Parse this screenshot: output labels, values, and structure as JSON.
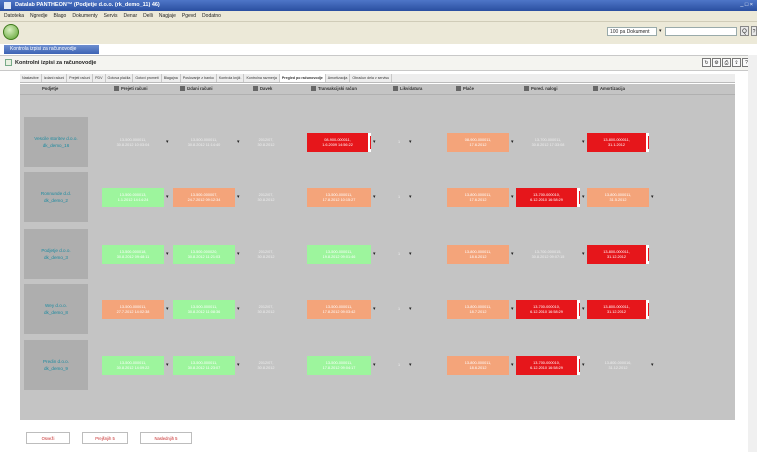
{
  "window": {
    "title": "Datalab PANTHEON™ (Podjetje d.o.o. (rk_demo_11) 46)",
    "controls": "_ □ ×"
  },
  "menu": [
    "Datoteka",
    "Ngredje",
    "Blago",
    "Dokumenty",
    "Servis",
    "Denar",
    "Delli",
    "Nagjaje",
    "Pgevd",
    "Dodatno"
  ],
  "toolbar": {
    "doc_select_label": "100 pa",
    "doc_select_value": "Dokument",
    "search_btn": "Q",
    "help_btn": "?"
  },
  "doc_tab": "Kontrola izpisi za računovodje",
  "panel": {
    "title": "Kontrolni izpisi za računovodje",
    "icons": [
      "refresh-icon",
      "settings-icon",
      "print-icon",
      "export-icon",
      "help-icon"
    ]
  },
  "nav_tabs": [
    "Nastavitve",
    "Izdani računi",
    "Prejeti računi",
    "PDV",
    "Gotova plačila",
    "Gotovi prometi",
    "Blagajna",
    "Poslovanje z banko",
    "Kontrola knjiž.",
    "Kontrolna razmerja",
    "Pregled po računovodje",
    "Amortizacija",
    "Obračun dela v servisu"
  ],
  "active_tab_index": 10,
  "columns": [
    {
      "key": "company",
      "label": "Podjetje",
      "icon": ""
    },
    {
      "key": "received",
      "label": "Prejeti računi",
      "icon": "inbox-icon"
    },
    {
      "key": "issued",
      "label": "Izdani računi",
      "icon": "outbox-icon"
    },
    {
      "key": "tax",
      "label": "Davek",
      "icon": "tax-icon"
    },
    {
      "key": "transactions",
      "label": "Transakcijski račun",
      "icon": "bank-icon"
    },
    {
      "key": "liquidity",
      "label": "Likvidatura",
      "icon": "list-icon"
    },
    {
      "key": "payroll",
      "label": "Plače",
      "icon": "people-icon"
    },
    {
      "key": "fixed",
      "label": "Pored. nalogi",
      "icon": "chart-icon"
    },
    {
      "key": "depreciation",
      "label": "Amortizacija",
      "icon": "doc-icon"
    }
  ],
  "rows": [
    {
      "company": [
        "Vescile storitev d.o.o.",
        "dk_demo_16"
      ],
      "received": {
        "status": "plain",
        "lines": [
          "13-500-000011,",
          "30.8.2012 10:03:04"
        ]
      },
      "issued": {
        "status": "plain",
        "lines": [
          "13-500-000011,",
          "30.8.2012 11:14:40"
        ]
      },
      "tax": {
        "status": "plain",
        "lines": [
          "2012/07,",
          "30.8.2012"
        ]
      },
      "transactions": {
        "status": "red",
        "lines": [
          "08-900-000011,",
          "1.6.2009 14:56:22"
        ]
      },
      "liquidity": {
        "status": "plain",
        "lines": [
          "1"
        ]
      },
      "payroll": {
        "status": "orange",
        "lines": [
          "08-900-000011,",
          "17.6.2012"
        ]
      },
      "fixed": {
        "status": "plain",
        "lines": [
          "13-700-000011,",
          "30.8.2012 17:33:08"
        ]
      },
      "depreciation": {
        "status": "red",
        "lines": [
          "13-800-000011,",
          "31.1.2012"
        ]
      }
    },
    {
      "company": [
        "Ronnunde d.d.",
        "dk_demo_2"
      ],
      "received": {
        "status": "green",
        "lines": [
          "13-500-000013,",
          "1.1.2012 14:14:24"
        ]
      },
      "issued": {
        "status": "orange",
        "lines": [
          "13-500-000007,",
          "24.7.2012 09:12:34"
        ]
      },
      "tax": {
        "status": "plain",
        "lines": [
          "2012/07,",
          "30.8.2012"
        ]
      },
      "transactions": {
        "status": "orange",
        "lines": [
          "13-500-000011,",
          "17.8.2012 10:15:27"
        ]
      },
      "liquidity": {
        "status": "plain",
        "lines": [
          "1"
        ]
      },
      "payroll": {
        "status": "orange",
        "lines": [
          "13-800-000011,",
          "17.6.2012"
        ]
      },
      "fixed": {
        "status": "red",
        "lines": [
          "13-700-000010,",
          "6.12.2010 16:58:29"
        ]
      },
      "depreciation": {
        "status": "orange",
        "lines": [
          "13-800-000011,",
          "31.5.2012"
        ]
      }
    },
    {
      "company": [
        "Podjetje d.o.o.",
        "dk_demo_3"
      ],
      "received": {
        "status": "green",
        "lines": [
          "13-500-000018,",
          "30.8.2012 09:48:11"
        ]
      },
      "issued": {
        "status": "green",
        "lines": [
          "13-500-000020,",
          "30.8.2012 11:21:03"
        ]
      },
      "tax": {
        "status": "plain",
        "lines": [
          "2012/07,",
          "30.8.2012"
        ]
      },
      "transactions": {
        "status": "green",
        "lines": [
          "13-500-000011,",
          "19.8.2012 09:01:46"
        ]
      },
      "liquidity": {
        "status": "plain",
        "lines": [
          "1"
        ]
      },
      "payroll": {
        "status": "orange",
        "lines": [
          "13-800-000011,",
          "18.6.2012"
        ]
      },
      "fixed": {
        "status": "plain",
        "lines": [
          "13-700-000015,",
          "30.8.2012 09:07:15"
        ]
      },
      "depreciation": {
        "status": "red",
        "lines": [
          "13-800-000011,",
          "31.12.2012"
        ]
      }
    },
    {
      "company": [
        "Wey d.o.o.",
        "dk_demo_8"
      ],
      "received": {
        "status": "orange",
        "lines": [
          "13-500-000011,",
          "27.7.2012 14:02:38"
        ]
      },
      "issued": {
        "status": "green",
        "lines": [
          "13-500-000011,",
          "30.8.2012 11:08:36"
        ]
      },
      "tax": {
        "status": "plain",
        "lines": [
          "2012/07,",
          "30.8.2012"
        ]
      },
      "transactions": {
        "status": "orange",
        "lines": [
          "13-500-000011,",
          "17.8.2012 09:03:42"
        ]
      },
      "liquidity": {
        "status": "plain",
        "lines": [
          "1"
        ]
      },
      "payroll": {
        "status": "orange",
        "lines": [
          "13-800-000011,",
          "18.7.2012"
        ]
      },
      "fixed": {
        "status": "red",
        "lines": [
          "13-700-000010,",
          "6.12.2010 16:58:29"
        ]
      },
      "depreciation": {
        "status": "red",
        "lines": [
          "13-800-000011,",
          "31.12.2012"
        ]
      }
    },
    {
      "company": [
        "Predin d.o.o.",
        "dk_demo_9"
      ],
      "received": {
        "status": "green",
        "lines": [
          "13-500-000011,",
          "30.8.2012 14:09:22"
        ]
      },
      "issued": {
        "status": "green",
        "lines": [
          "13-500-000011,",
          "30.8.2012 11:23:07"
        ]
      },
      "tax": {
        "status": "plain",
        "lines": [
          "2012/07,",
          "30.8.2012"
        ]
      },
      "transactions": {
        "status": "green",
        "lines": [
          "13-500-000011,",
          "17.8.2012 09:04:17"
        ]
      },
      "liquidity": {
        "status": "plain",
        "lines": [
          "1"
        ]
      },
      "payroll": {
        "status": "orange",
        "lines": [
          "13-800-000011,",
          "18.6.2012"
        ]
      },
      "fixed": {
        "status": "red",
        "lines": [
          "13-700-000010,",
          "6.12.2010 16:58:29"
        ]
      },
      "depreciation": {
        "status": "plain",
        "lines": [
          "13-800-000016,",
          "31.12.2012"
        ]
      }
    }
  ],
  "pager": {
    "prev": "Osveži",
    "mid": "Prejšnjih 5",
    "next": "Naslednjih 5"
  },
  "colors": {
    "red": "#e6161b",
    "orange": "#f4a47a",
    "green": "#9df59d",
    "company_text": "#1b8aa0",
    "grid_bg": "#c4c4c4"
  }
}
